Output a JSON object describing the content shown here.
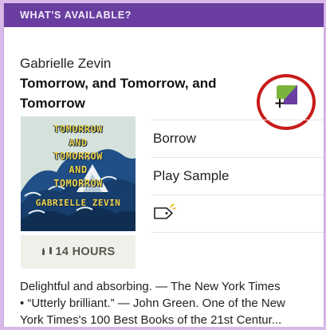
{
  "banner": {
    "label": "WHAT'S AVAILABLE?"
  },
  "book": {
    "author": "Gabrielle Zevin",
    "title": "Tomorrow, and Tomorrow, and Tomorrow",
    "cover_title_lines": [
      "TOMORROW",
      "AND",
      "TOMORROW",
      "AND",
      "TOMORROW"
    ],
    "cover_author": "GABRIELLE ZEVIN"
  },
  "actions": {
    "borrow_label": "Borrow",
    "sample_label": "Play Sample",
    "tag_icon": "tag-icon"
  },
  "duration": {
    "label": "14 HOURS",
    "icon": "headphones-icon"
  },
  "description": {
    "line1": "Delightful and absorbing. — The New York Times",
    "line2": "• “Utterly brilliant.” — John Green. One of the New",
    "line3": "York Times's 100 Best Books of the 21st Centur..."
  },
  "colors": {
    "banner_bg": "#6a3ea1",
    "highlight_ring": "#c81a1a",
    "add_icon_green": "#7ab43c",
    "add_icon_purple": "#6a3ea1"
  }
}
